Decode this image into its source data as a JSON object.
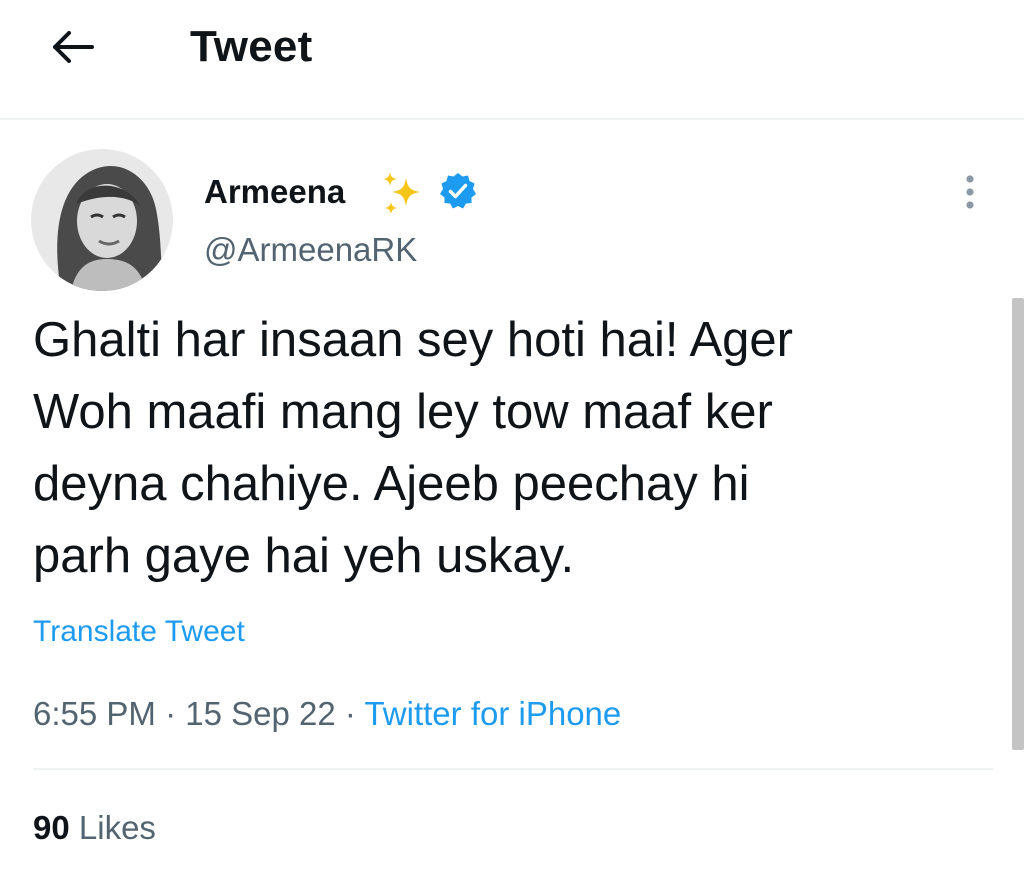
{
  "header": {
    "back_icon": "arrow-left-icon",
    "title": "Tweet"
  },
  "tweet": {
    "author": {
      "display_name": "Armeena",
      "name_emoji_icon": "sparkles-icon",
      "verified_icon": "verified-badge-icon",
      "handle": "@ArmeenaRK",
      "avatar_icon": "avatar-photo"
    },
    "more_icon": "more-vertical-icon",
    "text": "Ghalti har insaan sey hoti hai! Ager\nWoh maafi mang ley tow maaf ker\ndeyna chahiye. Ajeeb peechay hi\nparh gaye hai yeh uskay.",
    "translate_label": "Translate Tweet",
    "time": "6:55 PM",
    "separator": "·",
    "date": "15 Sep 22",
    "source": "Twitter for iPhone",
    "likes_count": "90",
    "likes_label": "Likes"
  },
  "colors": {
    "text_primary": "#0f1419",
    "text_secondary": "#536471",
    "accent": "#1d9bf0",
    "divider": "#eff3f4",
    "sparkle": "#f5c518"
  }
}
